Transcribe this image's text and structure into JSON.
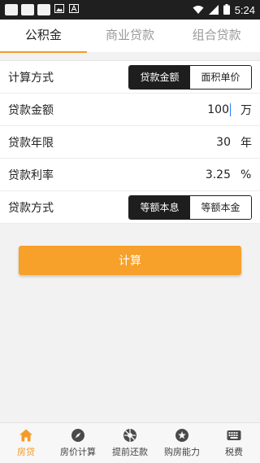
{
  "status_bar": {
    "time": "5:24"
  },
  "tabs": [
    {
      "label": "公积金",
      "active": true
    },
    {
      "label": "商业贷款",
      "active": false
    },
    {
      "label": "组合贷款",
      "active": false
    }
  ],
  "form": {
    "calc_method": {
      "label": "计算方式",
      "options": [
        "贷款金额",
        "面积单价"
      ],
      "selected": "贷款金额"
    },
    "loan_amount": {
      "label": "贷款金额",
      "value": "100",
      "unit": "万"
    },
    "loan_years": {
      "label": "贷款年限",
      "value": "30",
      "unit": "年"
    },
    "loan_rate": {
      "label": "贷款利率",
      "value": "3.25",
      "unit": "%"
    },
    "repay_method": {
      "label": "贷款方式",
      "options": [
        "等额本息",
        "等额本金"
      ],
      "selected": "等额本息"
    }
  },
  "calculate_button": {
    "label": "计算"
  },
  "bottom_nav": [
    {
      "label": "房贷",
      "icon": "home-icon",
      "active": true
    },
    {
      "label": "房价计算",
      "icon": "compass-icon",
      "active": false
    },
    {
      "label": "提前还款",
      "icon": "aperture-icon",
      "active": false
    },
    {
      "label": "购房能力",
      "icon": "star-icon",
      "active": false
    },
    {
      "label": "税费",
      "icon": "keyboard-icon",
      "active": false
    }
  ],
  "colors": {
    "accent": "#f39b2a",
    "button": "#f7a02a",
    "dark": "#1e1e1e"
  }
}
